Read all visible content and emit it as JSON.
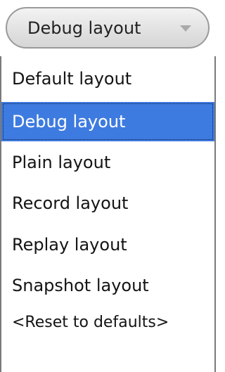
{
  "combo": {
    "selected_label": "Debug layout",
    "arrow_icon": "chevron-down-icon"
  },
  "dropdown": {
    "items": [
      {
        "label": "Default layout",
        "selected": false
      },
      {
        "label": "Debug layout",
        "selected": true
      },
      {
        "label": "Plain layout",
        "selected": false
      },
      {
        "label": "Record layout",
        "selected": false
      },
      {
        "label": "Replay layout",
        "selected": false
      },
      {
        "label": "Snapshot layout",
        "selected": false
      },
      {
        "label": "<Reset to defaults>",
        "selected": false
      }
    ]
  },
  "colors": {
    "selection": "#3e7be0",
    "selection_text": "#ffffff",
    "text": "#141414",
    "border": "#7a7a7a"
  }
}
